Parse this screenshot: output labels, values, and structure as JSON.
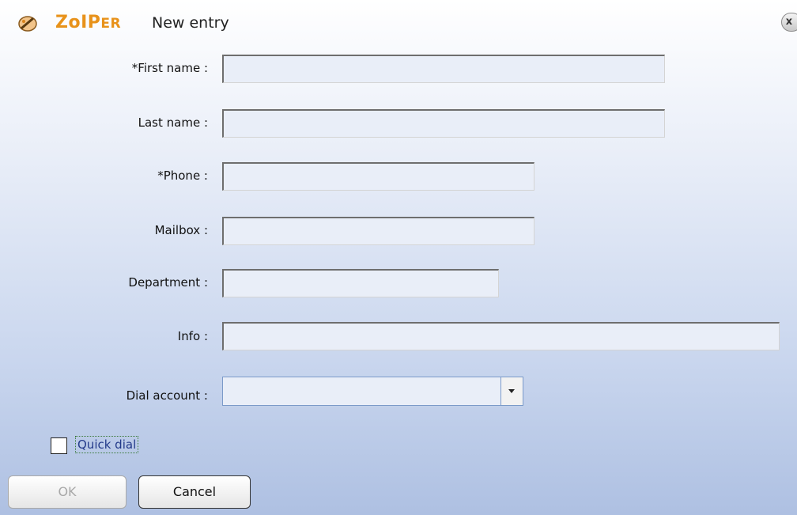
{
  "header": {
    "brand_main": "ZoIP",
    "brand_suffix": "ER",
    "title": "New entry",
    "close_label": "x"
  },
  "form": {
    "first_name": {
      "label": "*First name :",
      "value": ""
    },
    "last_name": {
      "label": "Last name :",
      "value": ""
    },
    "phone": {
      "label": "*Phone :",
      "value": ""
    },
    "mailbox": {
      "label": "Mailbox :",
      "value": ""
    },
    "department": {
      "label": "Department :",
      "value": ""
    },
    "info": {
      "label": "Info :",
      "value": ""
    },
    "dial_account": {
      "label": "Dial account :",
      "value": ""
    }
  },
  "quick_dial": {
    "label": "Quick dial",
    "checked": false
  },
  "buttons": {
    "ok": "OK",
    "cancel": "Cancel"
  },
  "colors": {
    "brand": "#e8921a",
    "bg_bottom": "#aec0e2",
    "field_bg": "#e9eef8"
  }
}
